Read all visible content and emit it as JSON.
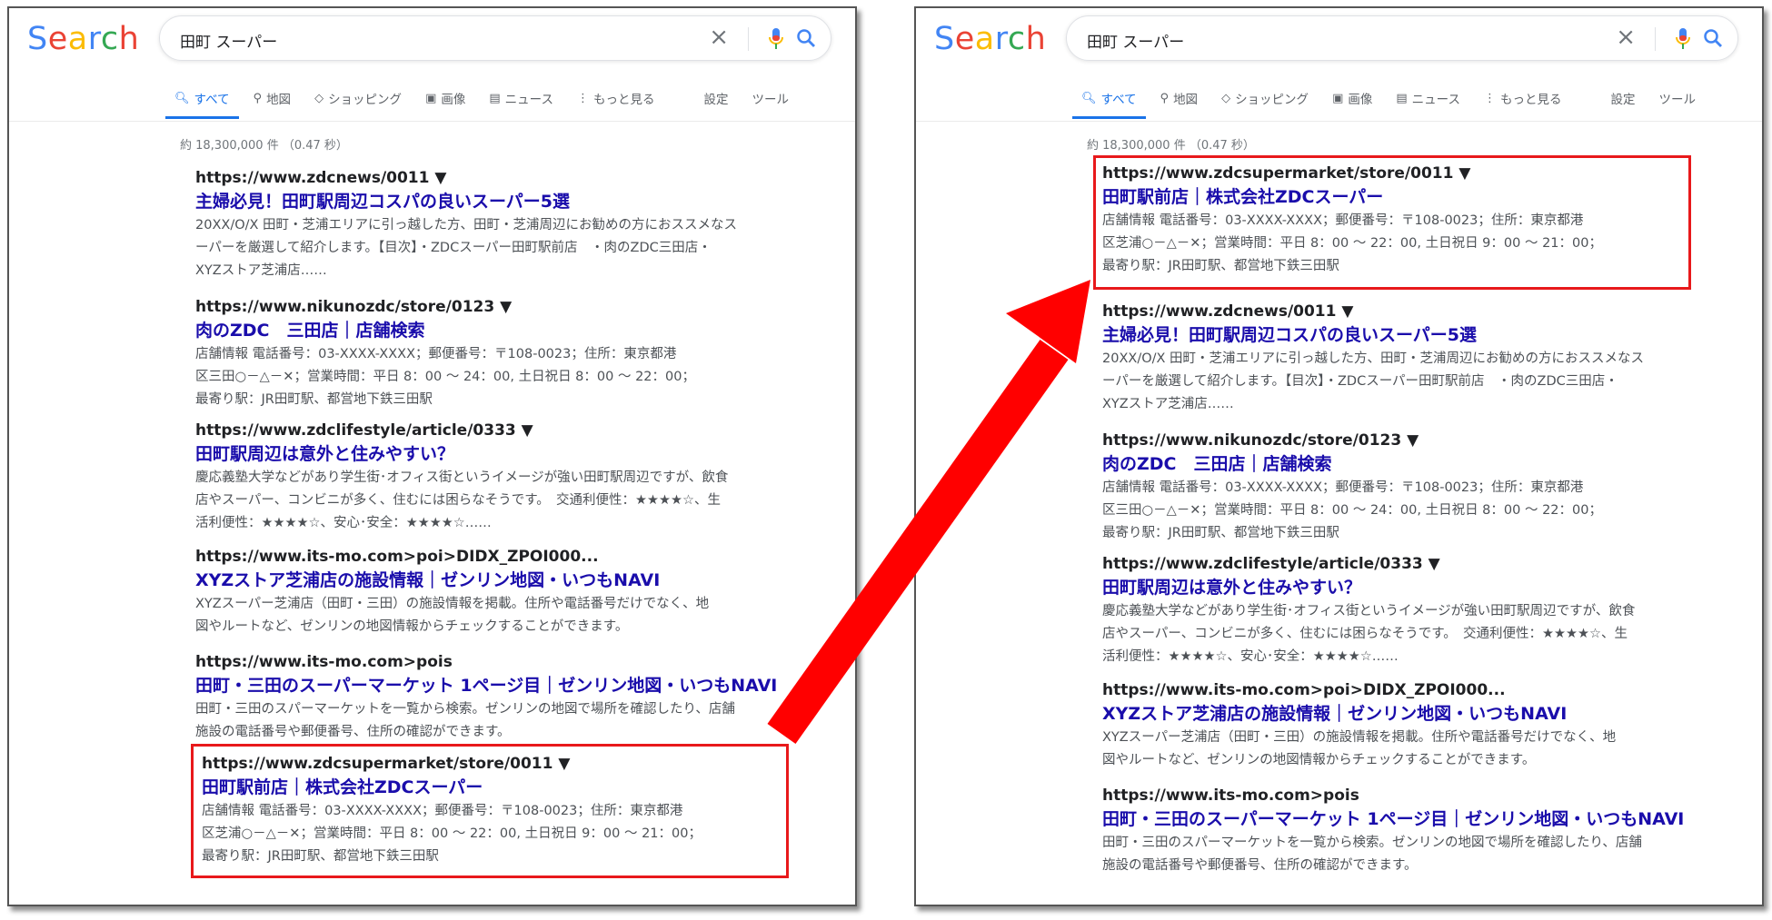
{
  "left": {
    "logo": "Search",
    "query": "田町 スーパー",
    "tabs": [
      "すべて",
      "地図",
      "ショッピング",
      "画像",
      "ニュース",
      "もっと見る",
      "設定",
      "ツール"
    ],
    "stats": "約 18,300,000 件 （0.47 秒）",
    "results": [
      {
        "url": "https://www.zdcnews/0011 ▼",
        "title": "主婦必見！田町駅周辺コスパの良いスーパー5選",
        "snippet": [
          "20XX/O/X 田町・芝浦エリアに引っ越した方、田町・芝浦周辺にお勧めの方におススメなス",
          "ーパーを厳選して紹介します。【目次】・ZDCスーパー田町駅前店　・肉のZDC三田店・",
          "XYZストア芝浦店……"
        ]
      },
      {
        "url": "https://www.nikunozdc/store/0123 ▼",
        "title": "肉のZDC　三田店｜店舗検索",
        "snippet": [
          "店舗情報 電話番号：03-XXXX-XXXX；郵便番号：〒108-0023；住所：東京都港",
          "区三田○－△－✕；営業時間：平日 8：00 ～ 24：00, 土日祝日 8：00 ～ 22：00；",
          "最寄り駅：JR田町駅、都営地下鉄三田駅"
        ]
      },
      {
        "url": "https://www.zdclifestyle/article/0333 ▼",
        "title": "田町駅周辺は意外と住みやすい？",
        "snippet": [
          "慶応義塾大学などがあり学生街･オフィス街というイメージが強い田町駅周辺ですが、飲食",
          "店やスーパー、コンビニが多く、住むには困らなそうです。　交通利便性：★★★★☆、生",
          "活利便性：★★★★☆、安心･安全：★★★★☆……"
        ]
      },
      {
        "url": "https://www.its-mo.com>poi>DIDX_ZPOI000...",
        "title": "XYZストア芝浦店の施設情報｜ゼンリン地図・いつもNAVI",
        "snippet": [
          "XYZスーパー芝浦店（田町・三田）の施設情報を掲載。住所や電話番号だけでなく、地",
          "図やルートなど、ゼンリンの地図情報からチェックすることができます。"
        ]
      },
      {
        "url": "https://www.its-mo.com>pois",
        "title": "田町・三田のスーパーマーケット 1ページ目｜ゼンリン地図・いつもNAVI",
        "snippet": [
          "田町・三田のスパーマーケットを一覧から検索。ゼンリンの地図で場所を確認したり、店舗",
          "施設の電話番号や郵便番号、住所の確認ができます。"
        ]
      },
      {
        "url": "https://www.zdcsupermarket/store/0011 ▼",
        "title": "田町駅前店｜株式会社ZDCスーパー",
        "snippet": [
          "店舗情報 電話番号：03-XXXX-XXXX；郵便番号：〒108-0023；住所：東京都港",
          "区芝浦○－△－✕；営業時間：平日 8：00 ～ 22：00, 土日祝日 9：00 ～ 21：00；",
          "最寄り駅：JR田町駅、都営地下鉄三田駅"
        ]
      }
    ]
  },
  "right": {
    "logo": "Search",
    "query": "田町 スーパー",
    "tabs": [
      "すべて",
      "地図",
      "ショッピング",
      "画像",
      "ニュース",
      "もっと見る",
      "設定",
      "ツール"
    ],
    "stats": "約 18,300,000 件 （0.47 秒）",
    "results": [
      {
        "url": "https://www.zdcsupermarket/store/0011 ▼",
        "title": "田町駅前店｜株式会社ZDCスーパー",
        "snippet": [
          "店舗情報 電話番号：03-XXXX-XXXX；郵便番号：〒108-0023；住所：東京都港",
          "区芝浦○－△－✕；営業時間：平日 8：00 ～ 22：00, 土日祝日 9：00 ～ 21：00；",
          "最寄り駅：JR田町駅、都営地下鉄三田駅"
        ]
      },
      {
        "url": "https://www.zdcnews/0011 ▼",
        "title": "主婦必見！田町駅周辺コスパの良いスーパー5選",
        "snippet": [
          "20XX/O/X 田町・芝浦エリアに引っ越した方、田町・芝浦周辺にお勧めの方におススメなス",
          "ーパーを厳選して紹介します。【目次】・ZDCスーパー田町駅前店　・肉のZDC三田店・",
          "XYZストア芝浦店……"
        ]
      },
      {
        "url": "https://www.nikunozdc/store/0123 ▼",
        "title": "肉のZDC　三田店｜店舗検索",
        "snippet": [
          "店舗情報 電話番号：03-XXXX-XXXX；郵便番号：〒108-0023；住所：東京都港",
          "区三田○－△－✕；営業時間：平日 8：00 ～ 24：00, 土日祝日 8：00 ～ 22：00；",
          "最寄り駅：JR田町駅、都営地下鉄三田駅"
        ]
      },
      {
        "url": "https://www.zdclifestyle/article/0333 ▼",
        "title": "田町駅周辺は意外と住みやすい？",
        "snippet": [
          "慶応義塾大学などがあり学生街･オフィス街というイメージが強い田町駅周辺ですが、飲食",
          "店やスーパー、コンビニが多く、住むには困らなそうです。　交通利便性：★★★★☆、生",
          "活利便性：★★★★☆、安心･安全：★★★★☆……"
        ]
      },
      {
        "url": "https://www.its-mo.com>poi>DIDX_ZPOI000...",
        "title": "XYZストア芝浦店の施設情報｜ゼンリン地図・いつもNAVI",
        "snippet": [
          "XYZスーパー芝浦店（田町・三田）の施設情報を掲載。住所や電話番号だけでなく、地",
          "図やルートなど、ゼンリンの地図情報からチェックすることができます。"
        ]
      },
      {
        "url": "https://www.its-mo.com>pois",
        "title": "田町・三田のスーパーマーケット 1ページ目｜ゼンリン地図・いつもNAVI",
        "snippet": [
          "田町・三田のスパーマーケットを一覧から検索。ゼンリンの地図で場所を確認したり、店舗",
          "施設の電話番号や郵便番号、住所の確認ができます。"
        ]
      }
    ]
  },
  "colors": {
    "link": "#1a0dab",
    "accent": "#1a73e8",
    "highlight": "#e8191b",
    "logo": [
      "#4285f4",
      "#ea4335",
      "#fbbc05",
      "#4285f4",
      "#34a853",
      "#ea4335"
    ]
  }
}
